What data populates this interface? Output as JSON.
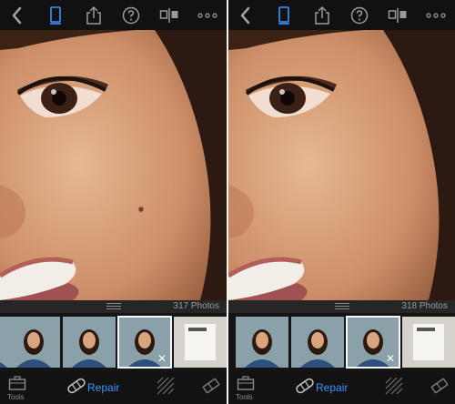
{
  "left": {
    "count": "317 Photos",
    "tools_label": "Tools",
    "repair_label": "Repair",
    "blemish": true
  },
  "right": {
    "count": "318 Photos",
    "tools_label": "Tools",
    "repair_label": "Repair",
    "blemish": false
  },
  "colors": {
    "accent": "#3d93ff",
    "icon": "#9a9a9a",
    "skin": "#d8a27b"
  },
  "icons": {
    "back": "chevron-left-icon",
    "compare": "compare-icon",
    "share": "share-icon",
    "help": "help-icon",
    "split": "split-view-icon",
    "more": "more-icon"
  }
}
